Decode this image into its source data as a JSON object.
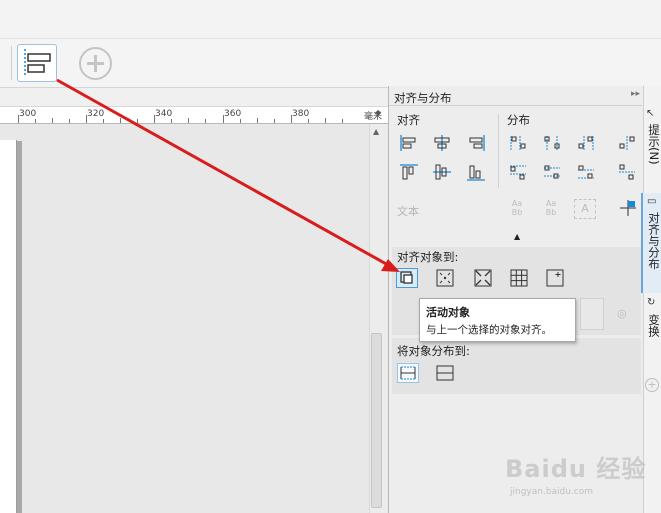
{
  "toolbar": {
    "align_tool_icon": "align-distribute-icon",
    "add_tool_icon": "plus-circle-icon"
  },
  "ruler": {
    "labels": [
      "300",
      "320",
      "340",
      "360",
      "380"
    ],
    "unit": "毫米"
  },
  "panel": {
    "title": "对齐与分布",
    "align_section": "对齐",
    "distribute_section": "分布",
    "text_label": "文本",
    "align_to_label": "对齐对象到:",
    "distribute_to_label": "将对象分布到:"
  },
  "tooltip": {
    "title": "活动对象",
    "description": "与上一个选择的对象对齐。"
  },
  "side_tabs": {
    "hints": "提示(N)",
    "align_distribute": "对齐与分布",
    "transform": "变换"
  },
  "watermark": {
    "text": "Baidu 经验",
    "sub": "jingyan.baidu.com"
  },
  "colors": {
    "annotation_arrow": "#d91c1c",
    "selection_blue": "#4e9ad8",
    "icon_blue": "#1a8ad4"
  }
}
